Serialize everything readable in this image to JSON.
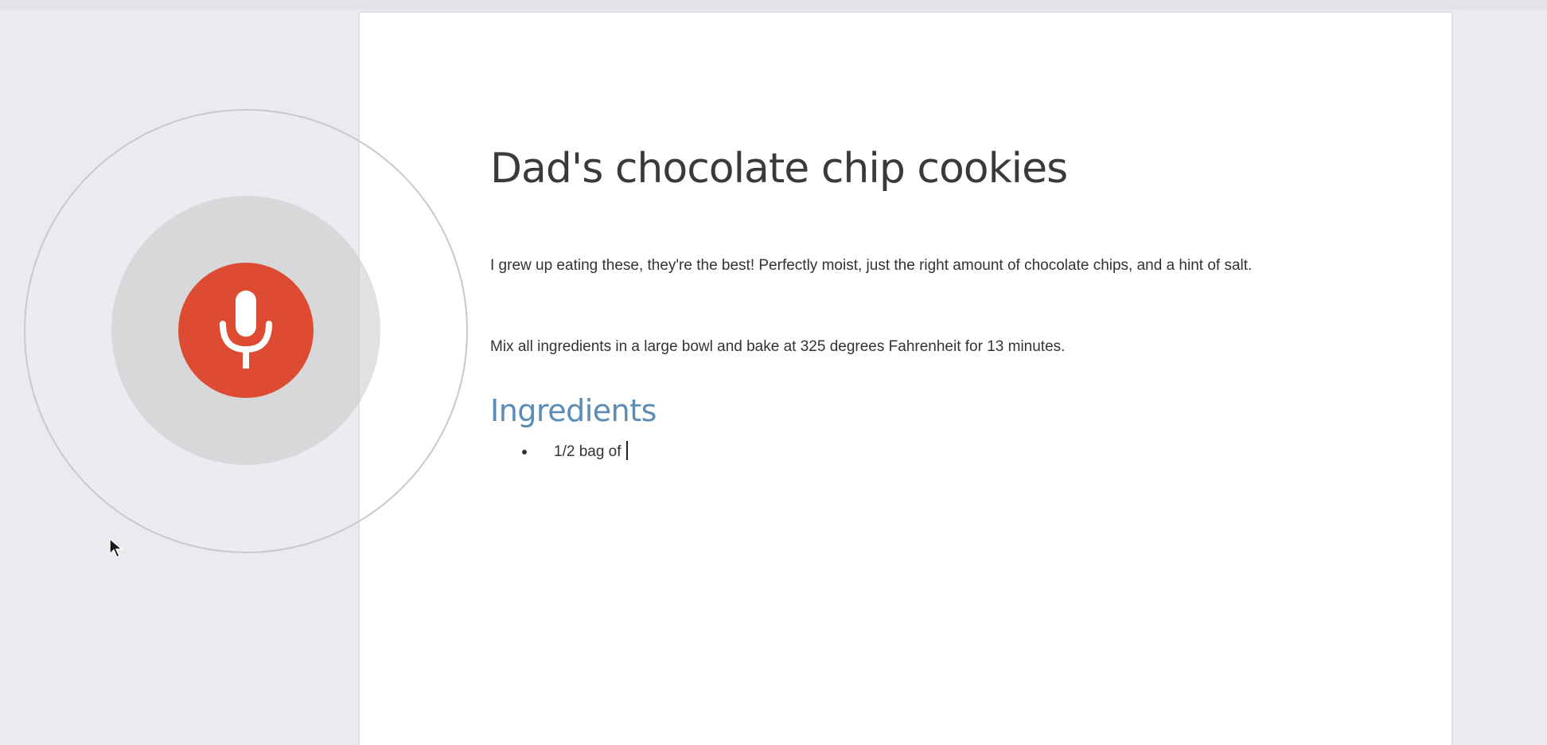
{
  "document": {
    "title": "Dad's chocolate chip cookies",
    "paragraphs": [
      "I grew up eating these, they're the best!  Perfectly moist, just the right amount of chocolate chips, and a hint of salt.",
      "Mix all ingredients in a large bowl and bake at 325 degrees Fahrenheit for 13 minutes."
    ],
    "ingredients_heading": "Ingredients",
    "ingredients": [
      "1/2 bag of"
    ]
  },
  "voice_typing": {
    "state": "listening",
    "mic_icon": "microphone-icon",
    "button_color": "#dd4b32",
    "heading_color": "#5b8db7"
  },
  "cursor_icon": "mouse-pointer-icon"
}
